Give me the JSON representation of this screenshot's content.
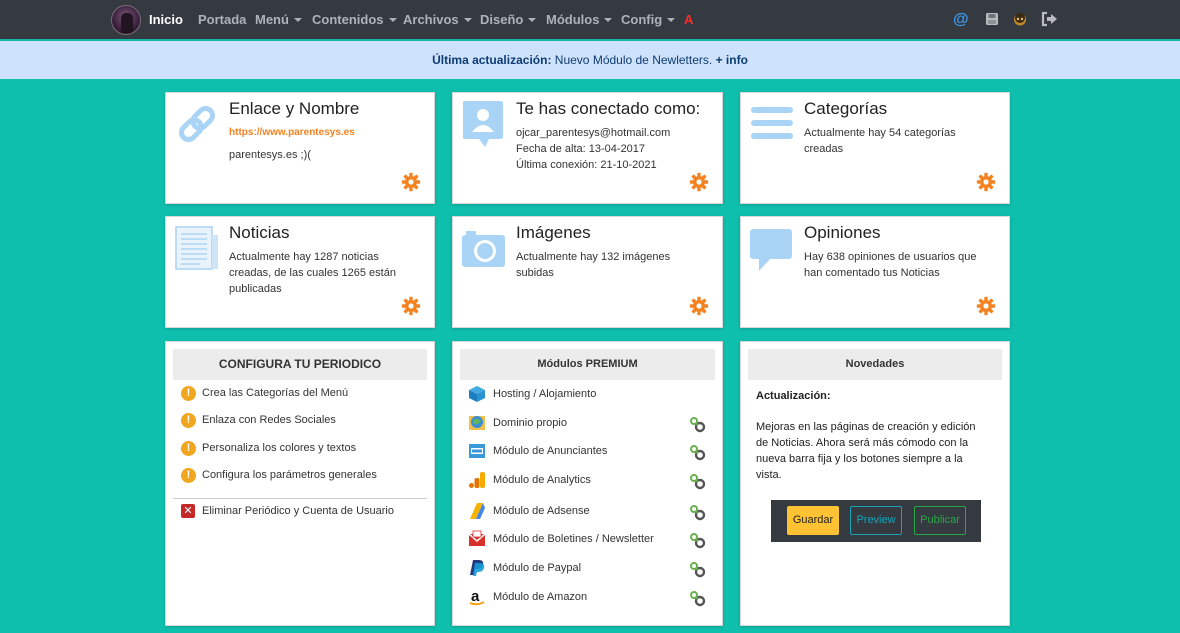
{
  "nav": {
    "home": "Inicio",
    "items": [
      {
        "label": "Portada",
        "caret": false
      },
      {
        "label": "Menú",
        "caret": true
      },
      {
        "label": "Contenidos",
        "caret": true
      },
      {
        "label": "Archivos",
        "caret": true
      },
      {
        "label": "Diseño",
        "caret": true
      },
      {
        "label": "Módulos",
        "caret": true
      },
      {
        "label": "Config",
        "caret": true
      }
    ],
    "alert_letter": "A",
    "right_icons": [
      "at-icon",
      "save-disk-icon",
      "user-face-icon",
      "sign-out-icon"
    ]
  },
  "alert": {
    "label": "Última actualización:",
    "text": "Nuevo Módulo de Newletters.",
    "link": "+ info"
  },
  "cards": {
    "enlace": {
      "title": "Enlace y Nombre",
      "url": "https://www.parentesys.es",
      "name": "parentesys.es ;)("
    },
    "conectado": {
      "title": "Te has conectado como:",
      "email": "ojcar_parentesys@hotmail.com",
      "alta": "Fecha de alta: 13-04-2017",
      "conexion": "Última conexión: 21-10-2021"
    },
    "categorias": {
      "title": "Categorías",
      "text": "Actualmente hay 54 categorías creadas"
    },
    "noticias": {
      "title": "Noticias",
      "text": "Actualmente hay 1287 noticias creadas, de las cuales 1265 están publicadas"
    },
    "imagenes": {
      "title": "Imágenes",
      "text": "Actualmente hay 132 imágenes subidas"
    },
    "opiniones": {
      "title": "Opiniones",
      "text": "Hay 638 opiniones de usuarios que han comentado tus Noticias"
    }
  },
  "configura": {
    "title": "CONFIGURA TU PERIODICO",
    "items": [
      "Crea las Categorías del Menú",
      "Enlaza con Redes Sociales",
      "Personaliza los colores y textos",
      "Configura los parámetros generales"
    ],
    "delete": "Eliminar Periódico y Cuenta de Usuario"
  },
  "premium": {
    "title": "Módulos PREMIUM",
    "items": [
      {
        "label": "Hosting / Alojamiento",
        "icon": "hosting-cube-icon",
        "link": false
      },
      {
        "label": "Dominio propio",
        "icon": "globe-icon",
        "link": true
      },
      {
        "label": "Módulo de Anunciantes",
        "icon": "ads-icon",
        "link": true
      },
      {
        "label": "Módulo de Analytics",
        "icon": "analytics-icon",
        "link": true
      },
      {
        "label": "Módulo de Adsense",
        "icon": "adsense-icon",
        "link": true
      },
      {
        "label": "Módulo de Boletines / Newsletter",
        "icon": "mail-icon",
        "link": true
      },
      {
        "label": "Módulo de Paypal",
        "icon": "paypal-icon",
        "link": true
      },
      {
        "label": "Módulo de Amazon",
        "icon": "amazon-icon",
        "link": true
      }
    ]
  },
  "novedades": {
    "title": "Novedades",
    "subtitle": "Actualización:",
    "text": "Mejoras en las páginas de creación y edición de Noticias. Ahora será más cómodo con la nueva barra fija y los botones siempre a la vista.",
    "buttons": {
      "save": "Guardar",
      "preview": "Preview",
      "publish": "Publicar"
    }
  },
  "colors": {
    "background": "#0fbfae",
    "nav": "#343a40",
    "alert_bg": "#cfe2fb",
    "gear": "#f58220",
    "url": "#f58220",
    "icon_blue": "#a9d4f5"
  }
}
